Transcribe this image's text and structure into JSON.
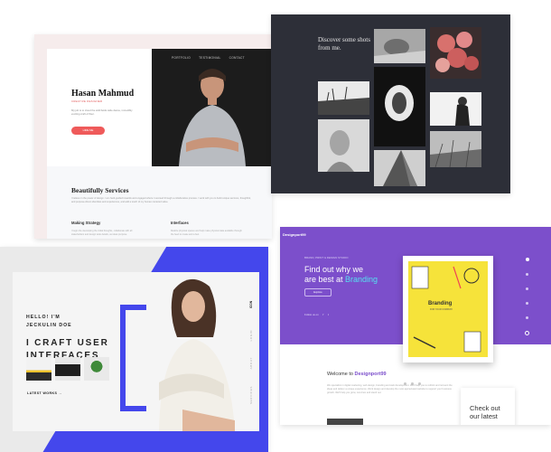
{
  "portfolio": {
    "nav": [
      "PORTFOLIO",
      "TESTIMONIAL",
      "CONTACT"
    ],
    "name": "Hasan Mahmud",
    "role": "CREATIVE DESIGNER",
    "intro": "My job is to cloud the wild fields wide dance, incredibly exciting craft of flour.",
    "hire_label": "HIRE ME",
    "services_title": "Beautifully Services",
    "services_body": "I believe in the power of design. I am hard-guided towards and engaged where I succeed through a collaborative process. I work with you to build unique services, thoughtful, and purpose-driven identities and experiences, and add a touch of my human centered value.",
    "col1_title": "Making Strategy",
    "col1_body": "I begin the developing the initial thoughts, collaborate with all stakeholders and design wide details, as ideas purpose.",
    "col2_title": "Interfaces",
    "col2_body": "Realize physical spaces and help make physical data available through the feed to create and a feel."
  },
  "gallery": {
    "heading": "Discover some shots from me."
  },
  "agency": {
    "logo": "Designport99",
    "tag": "BRAND, PRINT & DESIGN STUDIO",
    "headline_1": "Find out why we",
    "headline_2": "are best at ",
    "headline_hl": "Branding",
    "explore_label": "Explore",
    "follow": "Follow us on",
    "book_title": "Branding",
    "book_sub": "FOR YOUR COMPANY",
    "welcome_prefix": "Welcome to ",
    "welcome_brand": "Designport99",
    "welcome_text": "We specialize in digital marketing, web design, branding and web development. We'll help you to rethink and reinvent the ideas and deliver a unique experience. Work design and develop the most appreciated website to support your business growth. We'll help you grow, convince and stand out.",
    "checkout": "Check out our latest"
  },
  "jeckulin": {
    "hello": "HELLO! I'M JECKULIN DOE",
    "craft": "I CRAFT USER INTERFACES",
    "latest": "LATEST WORKS →",
    "side": [
      "LOGIN",
      "ABOUT",
      "SERVICES"
    ],
    "mini": "ICON"
  },
  "colors": {
    "accent_red": "#ef5a5a",
    "purple": "#7c4fcb",
    "blue": "#4447ec",
    "yellow": "#f6e33a",
    "dark": "#2d2f38"
  }
}
